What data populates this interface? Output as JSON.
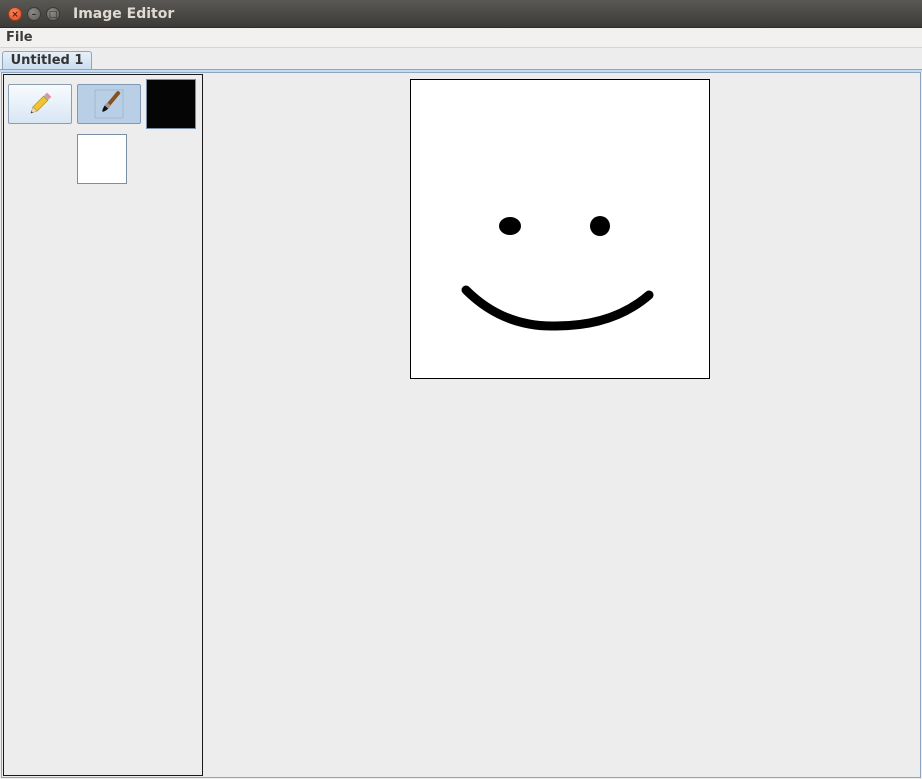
{
  "window": {
    "title": "Image Editor",
    "controls": {
      "close": "×",
      "minimize": "–",
      "maximize": "□"
    }
  },
  "menubar": {
    "items": [
      "File"
    ]
  },
  "tabs": [
    {
      "label": "Untitled 1",
      "active": true
    }
  ],
  "toolbox": {
    "tools": [
      {
        "name": "pencil",
        "icon": "pencil-icon",
        "selected": false
      },
      {
        "name": "brush",
        "icon": "paintbrush-icon",
        "selected": true
      }
    ],
    "primary_color": "#050505",
    "secondary_color": "#ffffff"
  },
  "canvas": {
    "background": "#ffffff",
    "stroke_color": "#000000",
    "drawing": "smiley-face"
  }
}
